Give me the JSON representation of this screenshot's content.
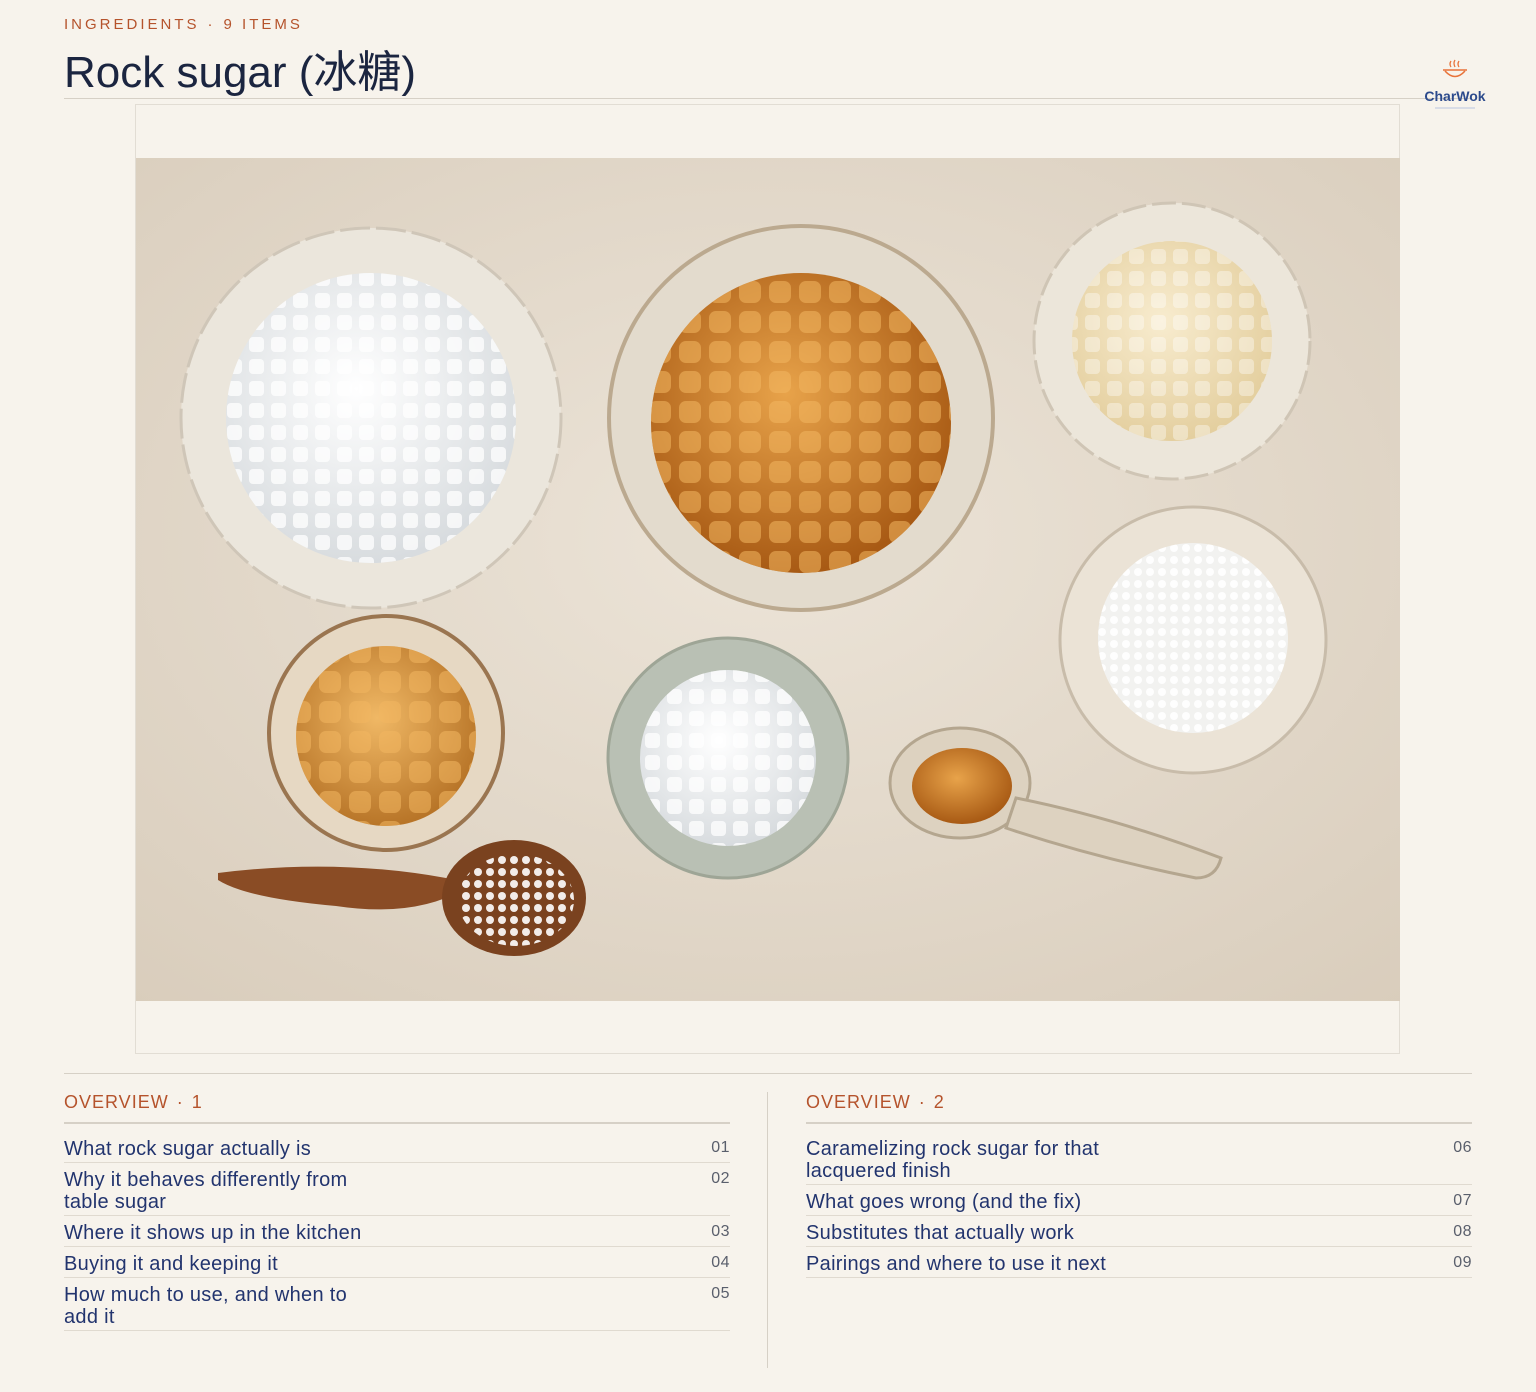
{
  "header": {
    "eyebrow_section": "INGREDIENTS",
    "eyebrow_count": "9 ITEMS",
    "eyebrow_dot": "·",
    "title": "Rock sugar (冰糖)"
  },
  "logo": {
    "text": "CharWok",
    "icon": "steaming-wok-icon",
    "color": "#e8733a"
  },
  "photo": {
    "description_icon": "rock-sugar-bowls-photo"
  },
  "toc": {
    "left": {
      "heading": "OVERVIEW",
      "heading_sep": "·",
      "heading_num": "1",
      "items": [
        {
          "label": "What rock sugar actually is",
          "num": "01"
        },
        {
          "label": "Why it behaves differently from table sugar",
          "num": "02"
        },
        {
          "label": "Where it shows up in the kitchen",
          "num": "03"
        },
        {
          "label": "Buying it and keeping it",
          "num": "04"
        },
        {
          "label": "How much to use, and when to add it",
          "num": "05"
        }
      ]
    },
    "right": {
      "heading": "OVERVIEW",
      "heading_sep": "·",
      "heading_num": "2",
      "items": [
        {
          "label": "Caramelizing rock sugar for that lacquered finish",
          "num": "06"
        },
        {
          "label": "What goes wrong (and the fix)",
          "num": "07"
        },
        {
          "label": "Substitutes that actually work",
          "num": "08"
        },
        {
          "label": "Pairings and where to use it next",
          "num": "09"
        }
      ]
    }
  },
  "colors": {
    "accent": "#b5532c",
    "ink": "#1b2540",
    "link": "#22346e",
    "background": "#f7f3ec"
  }
}
